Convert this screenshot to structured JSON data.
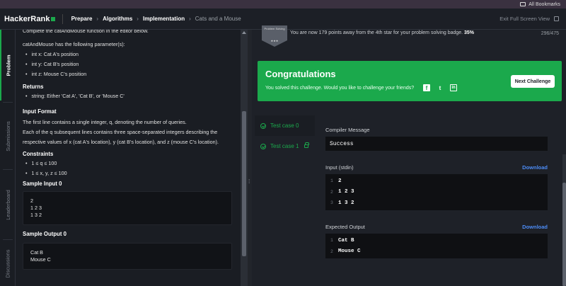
{
  "browser": {
    "bookmarks_label": "All Bookmarks"
  },
  "header": {
    "logo": "HackerRank",
    "breadcrumbs": [
      "Prepare",
      "Algorithms",
      "Implementation",
      "Cats and a Mouse"
    ],
    "exit_fullscreen": "Exit Full Screen View"
  },
  "vtabs": [
    "Problem",
    "Submissions",
    "Leaderboard",
    "Discussions"
  ],
  "problem": {
    "intro": "Complete the catAndMouse function in the editor below.",
    "params_intro": "catAndMouse has the following parameter(s):",
    "params": [
      "int x: Cat A's position",
      "int y: Cat B's position",
      "int z: Mouse C's position"
    ],
    "returns_h": "Returns",
    "returns": [
      "string: Either 'Cat A', 'Cat B', or 'Mouse C'"
    ],
    "input_format_h": "Input Format",
    "input_format_1": "The first line contains a single integer, q, denoting the number of queries.",
    "input_format_2": "Each of the q subsequent lines contains three space-separated integers describing the",
    "input_format_3": "respective values of x (cat A's location), y (cat B's location), and z (mouse C's location).",
    "constraints_h": "Constraints",
    "constraints": [
      "1 ≤ q ≤ 100",
      "1 ≤ x, y, z ≤ 100"
    ],
    "sample_input_h": "Sample Input 0",
    "sample_input": [
      "2",
      "1 2 3",
      "1 3 2"
    ],
    "sample_output_h": "Sample Output 0",
    "sample_output": [
      "Cat B",
      "Mouse C"
    ]
  },
  "badge": {
    "label": "Problem Solving",
    "stars": "★★★",
    "message": "You are now 179 points away from the 4th star for your problem solving badge.",
    "percent": "35%",
    "points": "296/475"
  },
  "congrats": {
    "title": "Congratulations",
    "subtitle": "You solved this challenge. Would you like to challenge your friends?",
    "social": [
      "f",
      "t",
      "in"
    ],
    "next_button": "Next Challenge",
    "accent": "#1ba94c"
  },
  "test_cases": [
    {
      "label": "Test case 0",
      "active": true,
      "locked": false
    },
    {
      "label": "Test case 1",
      "active": false,
      "locked": true
    }
  ],
  "compiler": {
    "label": "Compiler Message",
    "value": "Success"
  },
  "stdin": {
    "label": "Input (stdin)",
    "download": "Download",
    "lines": [
      {
        "n": "1",
        "text": "2"
      },
      {
        "n": "2",
        "text": "1 2 3"
      },
      {
        "n": "3",
        "text": "1 3 2"
      }
    ]
  },
  "expected": {
    "label": "Expected Output",
    "download": "Download",
    "lines": [
      {
        "n": "1",
        "text": "Cat B"
      },
      {
        "n": "2",
        "text": "Mouse C"
      }
    ]
  }
}
